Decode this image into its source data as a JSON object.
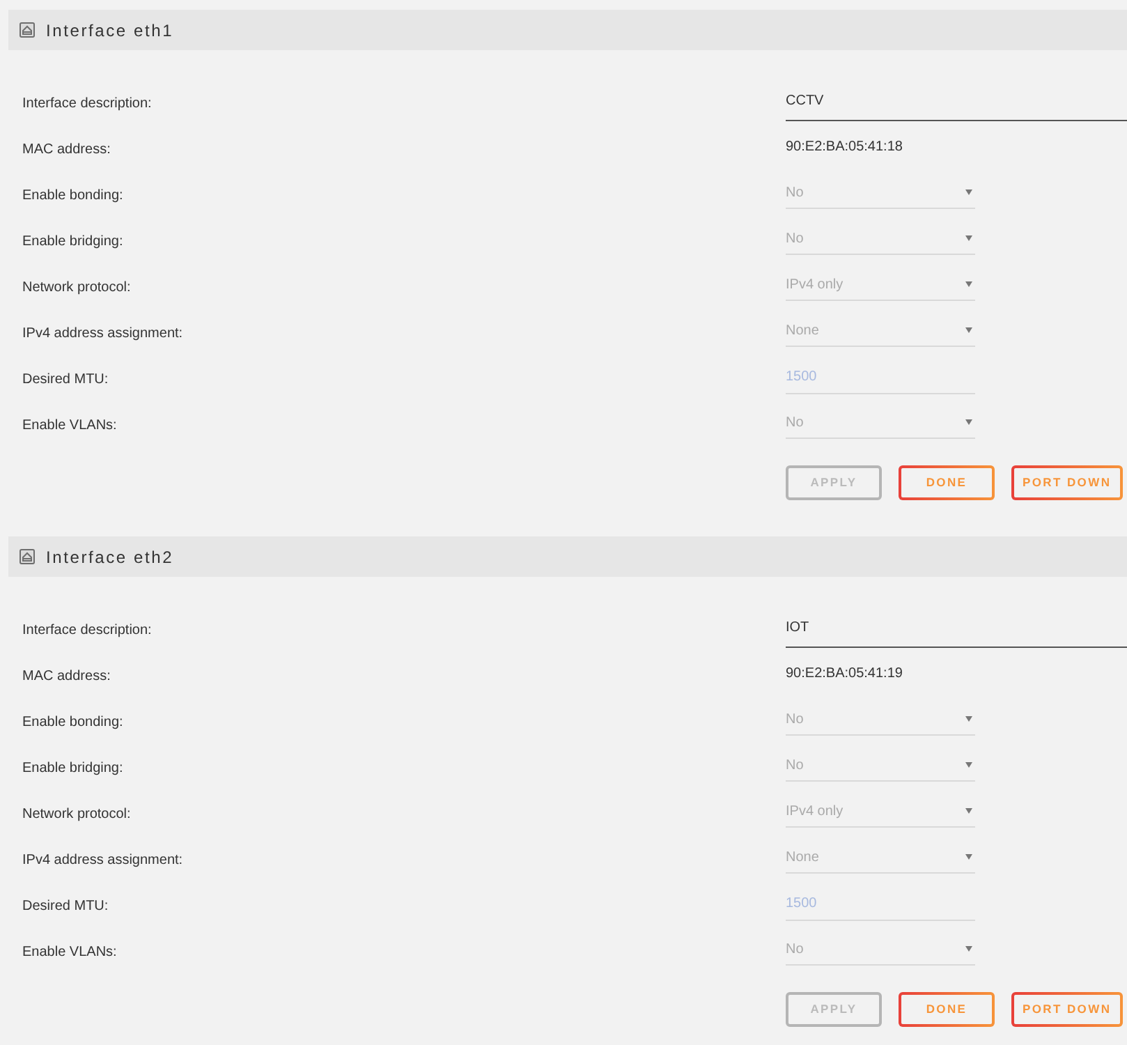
{
  "interfaces": [
    {
      "title": "Interface eth1",
      "fields": [
        {
          "label": "Interface description:",
          "kind": "text",
          "value": "CCTV"
        },
        {
          "label": "MAC address:",
          "kind": "static",
          "value": "90:E2:BA:05:41:18"
        },
        {
          "label": "Enable bonding:",
          "kind": "select",
          "value": "No",
          "disabled": true
        },
        {
          "label": "Enable bridging:",
          "kind": "select",
          "value": "No",
          "disabled": true
        },
        {
          "label": "Network protocol:",
          "kind": "select",
          "value": "IPv4 only",
          "disabled": true
        },
        {
          "label": "IPv4 address assignment:",
          "kind": "select",
          "value": "None",
          "disabled": true
        },
        {
          "label": "Desired MTU:",
          "kind": "number",
          "placeholder": "1500"
        },
        {
          "label": "Enable VLANs:",
          "kind": "select",
          "value": "No",
          "disabled": true
        }
      ],
      "buttons": [
        {
          "label": "APPLY",
          "disabled": true
        },
        {
          "label": "DONE",
          "disabled": false
        },
        {
          "label": "PORT DOWN",
          "disabled": false
        }
      ]
    },
    {
      "title": "Interface eth2",
      "fields": [
        {
          "label": "Interface description:",
          "kind": "text",
          "value": "IOT"
        },
        {
          "label": "MAC address:",
          "kind": "static",
          "value": "90:E2:BA:05:41:19"
        },
        {
          "label": "Enable bonding:",
          "kind": "select",
          "value": "No",
          "disabled": true
        },
        {
          "label": "Enable bridging:",
          "kind": "select",
          "value": "No",
          "disabled": true
        },
        {
          "label": "Network protocol:",
          "kind": "select",
          "value": "IPv4 only",
          "disabled": true
        },
        {
          "label": "IPv4 address assignment:",
          "kind": "select",
          "value": "None",
          "disabled": true
        },
        {
          "label": "Desired MTU:",
          "kind": "number",
          "placeholder": "1500"
        },
        {
          "label": "Enable VLANs:",
          "kind": "select",
          "value": "No",
          "disabled": true
        }
      ],
      "buttons": [
        {
          "label": "APPLY",
          "disabled": true
        },
        {
          "label": "DONE",
          "disabled": false
        },
        {
          "label": "PORT DOWN",
          "disabled": false
        }
      ]
    }
  ]
}
